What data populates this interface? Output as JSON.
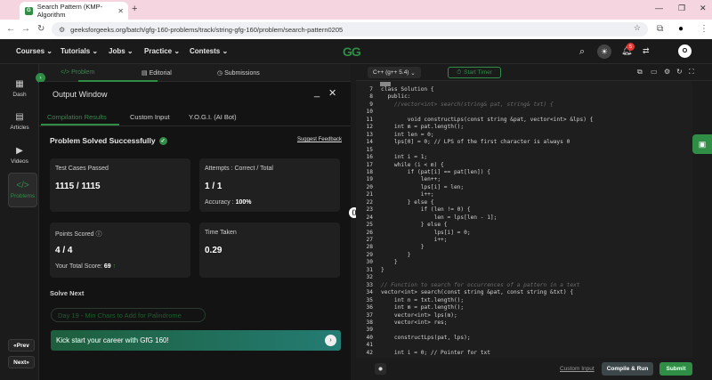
{
  "browser": {
    "tab_title": "Search Pattern (KMP-Algorithm",
    "new_tab": "+",
    "url": "geeksforgeeks.org/batch/gfg-160-problems/track/string-gfg-160/problem/search-pattern0205"
  },
  "site_nav": {
    "items": [
      "Courses",
      "Tutorials",
      "Jobs",
      "Practice",
      "Contests"
    ],
    "logo": "GG",
    "notif_count": "5",
    "avatar": "O"
  },
  "sidebar": {
    "items": [
      "Dash",
      "Articles",
      "Videos",
      "Problems"
    ],
    "prev": "Prev",
    "next": "Next"
  },
  "problem_tabs": [
    "Problem",
    "Editorial",
    "Submissions"
  ],
  "output": {
    "title": "Output Window",
    "tabs": [
      "Compilation Results",
      "Custom Input",
      "Y.O.G.I. (AI Bot)"
    ],
    "status": "Problem Solved Successfully",
    "feedback": "Suggest Feedback",
    "cards": {
      "tests_label": "Test Cases Passed",
      "tests_value": "1115 / 1115",
      "attempts_label": "Attempts : Correct / Total",
      "attempts_value": "1 / 1",
      "accuracy_label": "Accuracy : ",
      "accuracy_value": "100%",
      "points_label": "Points Scored",
      "points_value": "4 / 4",
      "total_label": "Your Total Score: ",
      "total_value": "69",
      "time_label": "Time Taken",
      "time_value": "0.29"
    },
    "solve_next": "Solve Next",
    "next_problem": "Day 19 - Min Chars to Add for Palindrome",
    "banner": "Kick start your career with GfG 160!"
  },
  "editor": {
    "language": "C++ (g++ 5.4)",
    "timer": "Start Timer",
    "custom_input": "Custom Input",
    "compile": "Compile & Run",
    "submit": "Submit",
    "lines": [
      {
        "n": "7",
        "t": "class Solution {"
      },
      {
        "n": "8",
        "t": "  public:"
      },
      {
        "n": "9",
        "t": "    //vector<int> search(string& pat, string& txt) {"
      },
      {
        "n": "10",
        "t": ""
      },
      {
        "n": "11",
        "t": "        void constructLps(const string &pat, vector<int> &lps) {"
      },
      {
        "n": "12",
        "t": "    int m = pat.length();"
      },
      {
        "n": "13",
        "t": "    int len = 0;"
      },
      {
        "n": "14",
        "t": "    lps[0] = 0; // LPS of the first character is always 0"
      },
      {
        "n": "15",
        "t": ""
      },
      {
        "n": "16",
        "t": "    int i = 1;"
      },
      {
        "n": "17",
        "t": "    while (i < m) {"
      },
      {
        "n": "18",
        "t": "        if (pat[i] == pat[len]) {"
      },
      {
        "n": "19",
        "t": "            len++;"
      },
      {
        "n": "20",
        "t": "            lps[i] = len;"
      },
      {
        "n": "21",
        "t": "            i++;"
      },
      {
        "n": "22",
        "t": "        } else {"
      },
      {
        "n": "23",
        "t": "            if (len != 0) {"
      },
      {
        "n": "24",
        "t": "                len = lps[len - 1];"
      },
      {
        "n": "25",
        "t": "            } else {"
      },
      {
        "n": "26",
        "t": "                lps[i] = 0;"
      },
      {
        "n": "27",
        "t": "                i++;"
      },
      {
        "n": "28",
        "t": "            }"
      },
      {
        "n": "29",
        "t": "        }"
      },
      {
        "n": "30",
        "t": "    }"
      },
      {
        "n": "31",
        "t": "}"
      },
      {
        "n": "32",
        "t": ""
      },
      {
        "n": "33",
        "t": "// Function to search for occurrences of a pattern in a text"
      },
      {
        "n": "34",
        "t": "vector<int> search(const string &pat, const string &txt) {"
      },
      {
        "n": "35",
        "t": "    int n = txt.length();"
      },
      {
        "n": "36",
        "t": "    int m = pat.length();"
      },
      {
        "n": "37",
        "t": "    vector<int> lps(m);"
      },
      {
        "n": "38",
        "t": "    vector<int> res;"
      },
      {
        "n": "39",
        "t": ""
      },
      {
        "n": "40",
        "t": "    constructLps(pat, lps);"
      },
      {
        "n": "41",
        "t": ""
      },
      {
        "n": "42",
        "t": "    int i = 0; // Pointer for txt"
      }
    ]
  }
}
